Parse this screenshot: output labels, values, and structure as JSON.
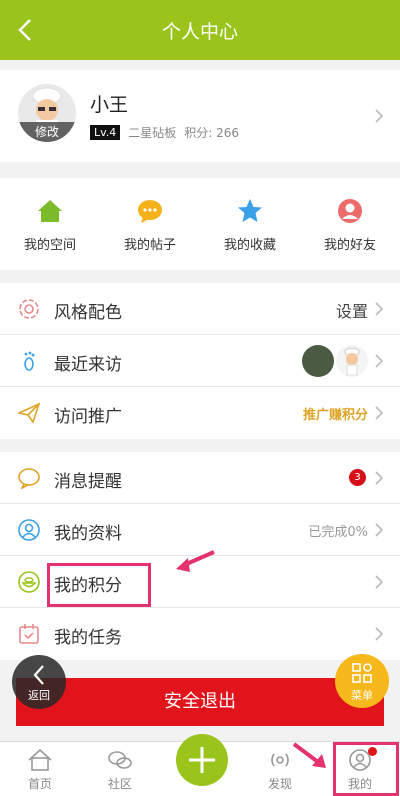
{
  "header": {
    "title": "个人中心"
  },
  "profile": {
    "name": "小王",
    "avatar_edit": "修改",
    "level": "Lv.4",
    "rank": "二星砧板",
    "points": "积分: 266"
  },
  "quick": [
    {
      "label": "我的空间",
      "icon": "home-icon",
      "color": "#7cbb2a"
    },
    {
      "label": "我的帖子",
      "icon": "chat-bubble-icon",
      "color": "#f5b11a"
    },
    {
      "label": "我的收藏",
      "icon": "star-icon",
      "color": "#3aa0e8"
    },
    {
      "label": "我的好友",
      "icon": "person-icon",
      "color": "#ee6b6b"
    }
  ],
  "group1": [
    {
      "label": "风格配色",
      "value": "设置"
    },
    {
      "label": "最近来访",
      "value": ""
    },
    {
      "label": "访问推广",
      "value": "推广赚积分"
    }
  ],
  "group2": [
    {
      "label": "消息提醒",
      "badge": "3"
    },
    {
      "label": "我的资料",
      "value": "已完成0%"
    },
    {
      "label": "我的积分",
      "value": ""
    },
    {
      "label": "我的任务",
      "value": ""
    }
  ],
  "actions": {
    "logout": "安全退出",
    "back": "返回",
    "menu": "菜单"
  },
  "tabs": [
    {
      "label": "首页"
    },
    {
      "label": "社区"
    },
    {
      "label": ""
    },
    {
      "label": "发现"
    },
    {
      "label": "我的"
    }
  ],
  "colors": {
    "brand": "#9ac31c",
    "danger": "#e1141b",
    "highlight": "#e3326d",
    "gold": "#e1a42a"
  }
}
